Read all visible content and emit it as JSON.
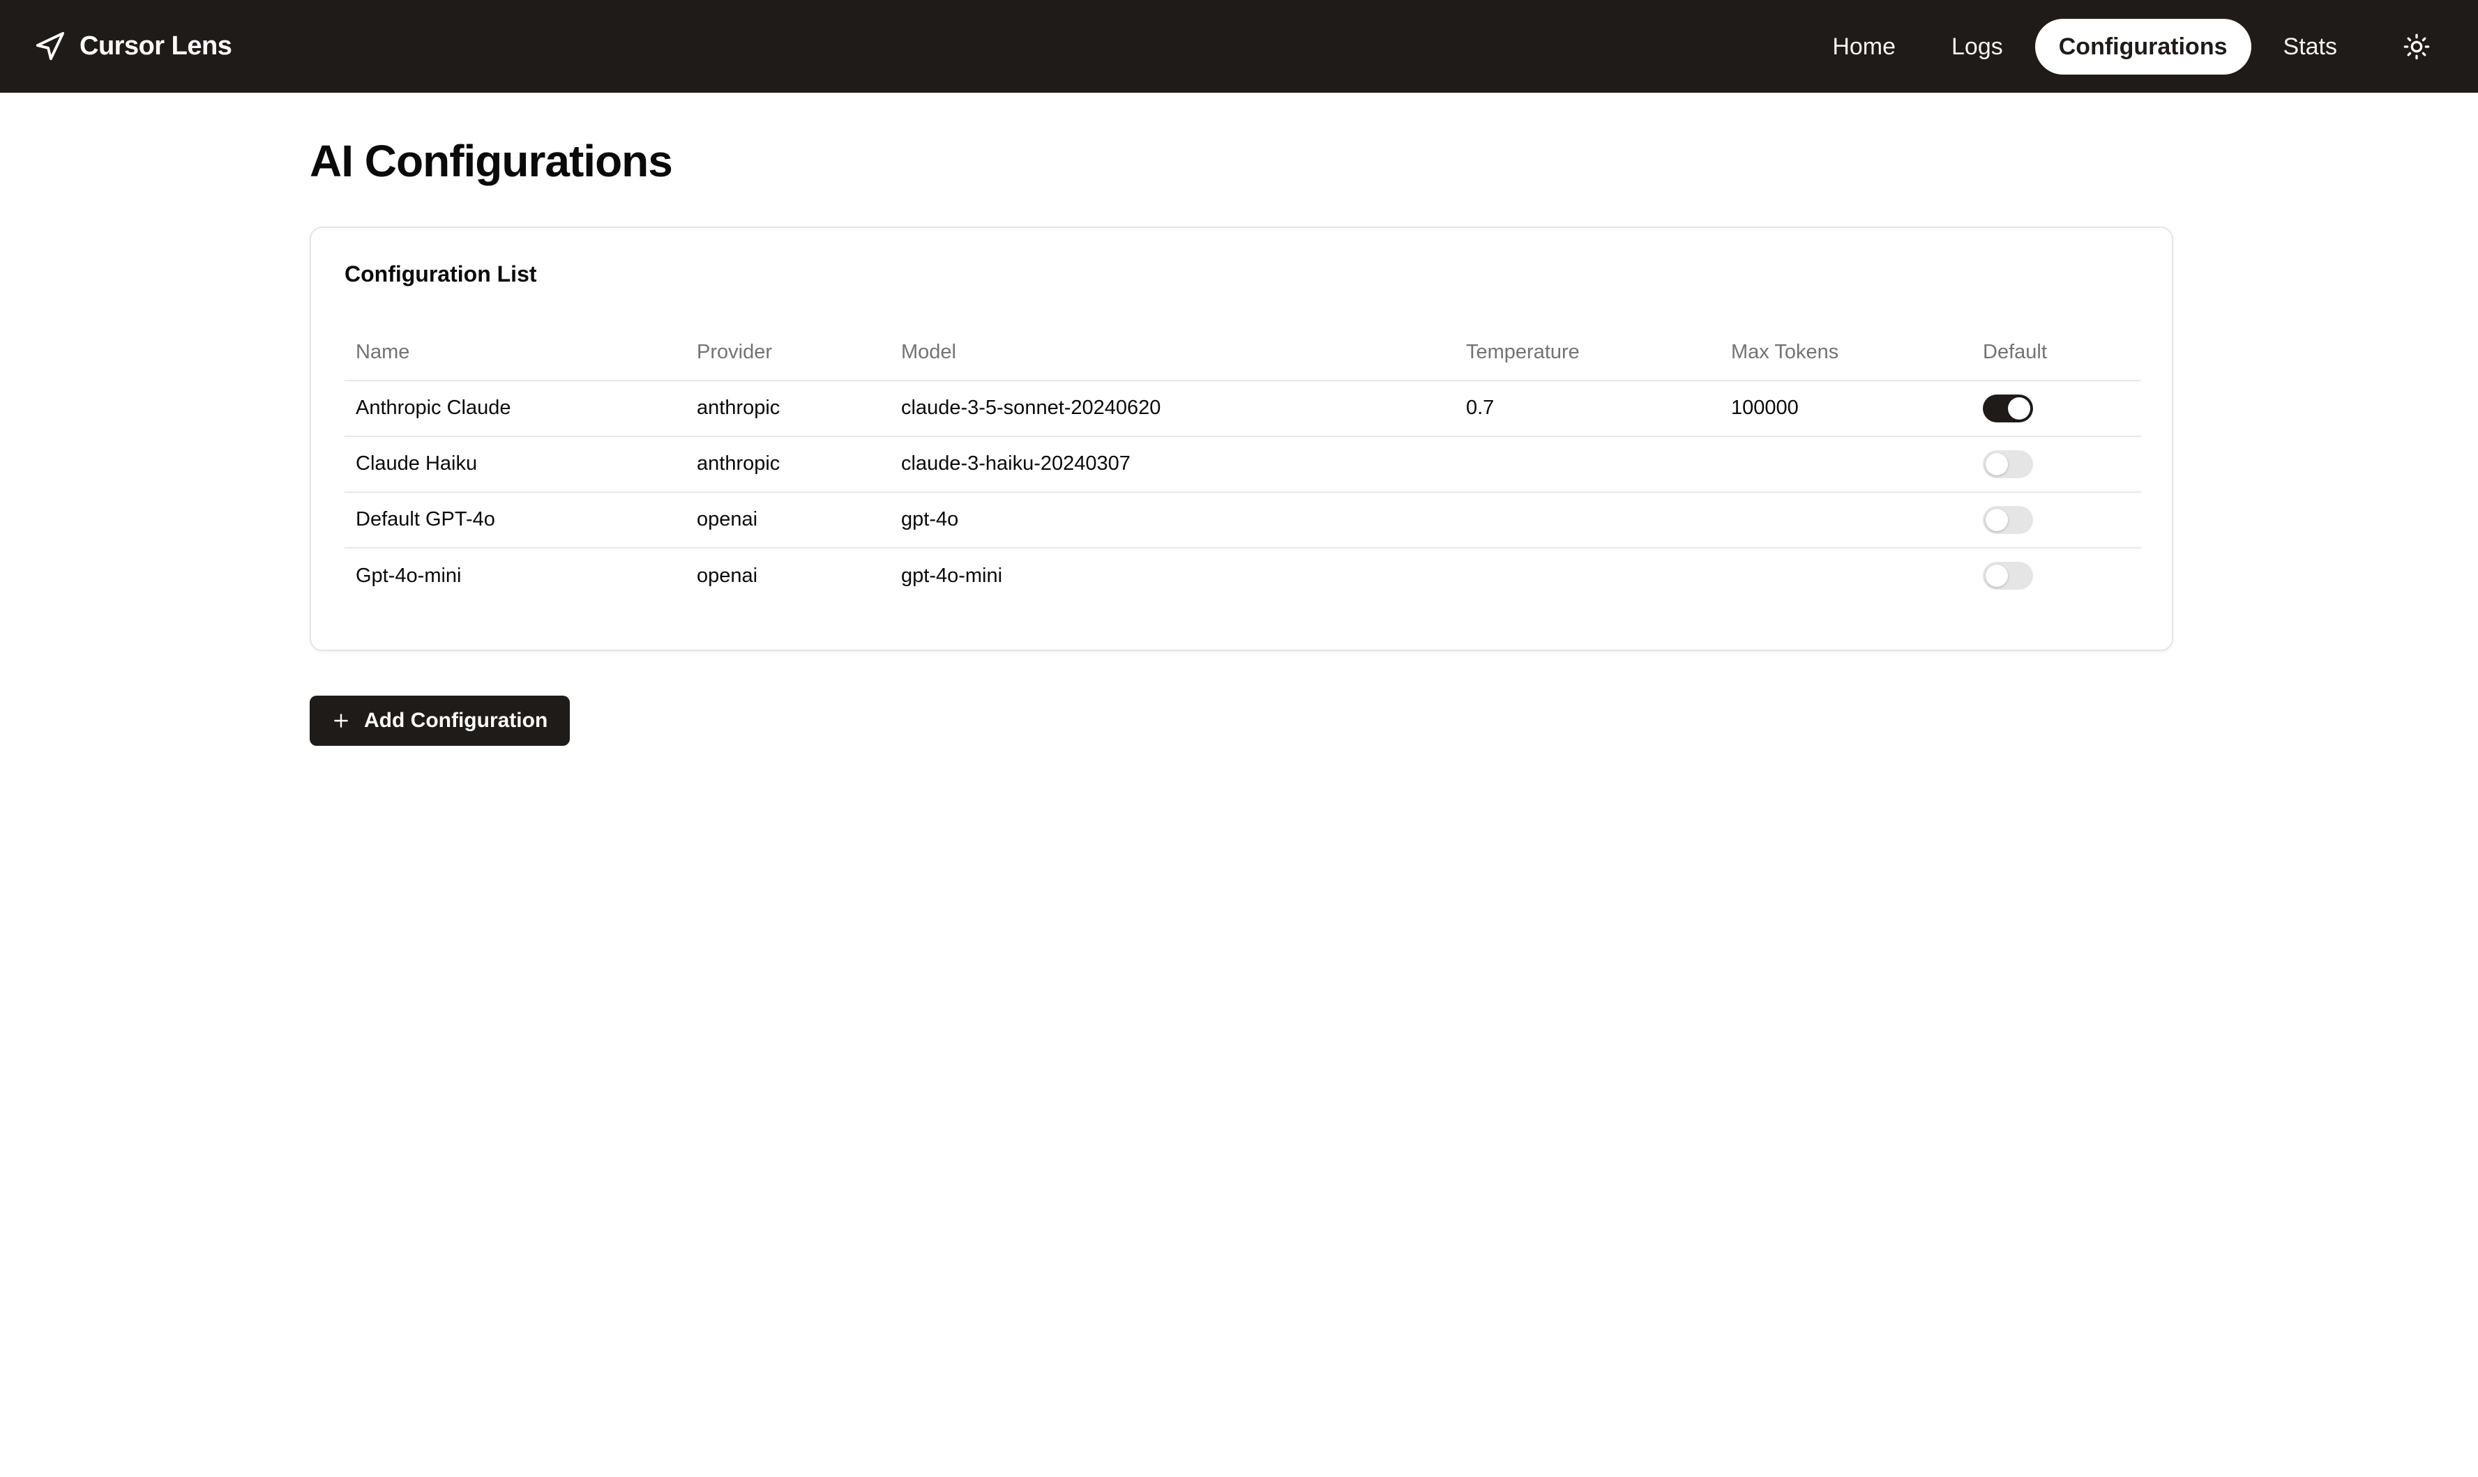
{
  "brand": {
    "name": "Cursor Lens",
    "icon": "navigation-arrow-icon"
  },
  "nav": {
    "items": [
      {
        "label": "Home",
        "active": false
      },
      {
        "label": "Logs",
        "active": false
      },
      {
        "label": "Configurations",
        "active": true
      },
      {
        "label": "Stats",
        "active": false
      }
    ],
    "theme_icon": "sun-icon"
  },
  "page": {
    "title": "AI Configurations"
  },
  "card": {
    "title": "Configuration List",
    "columns": [
      "Name",
      "Provider",
      "Model",
      "Temperature",
      "Max Tokens",
      "Default"
    ],
    "rows": [
      {
        "name": "Anthropic Claude",
        "provider": "anthropic",
        "model": "claude-3-5-sonnet-20240620",
        "temperature": "0.7",
        "max_tokens": "100000",
        "default": true
      },
      {
        "name": "Claude Haiku",
        "provider": "anthropic",
        "model": "claude-3-haiku-20240307",
        "temperature": "",
        "max_tokens": "",
        "default": false
      },
      {
        "name": "Default GPT-4o",
        "provider": "openai",
        "model": "gpt-4o",
        "temperature": "",
        "max_tokens": "",
        "default": false
      },
      {
        "name": "Gpt-4o-mini",
        "provider": "openai",
        "model": "gpt-4o-mini",
        "temperature": "",
        "max_tokens": "",
        "default": false
      }
    ]
  },
  "actions": {
    "add_label": "Add Configuration",
    "add_icon": "plus-icon"
  },
  "colors": {
    "nav_bg": "#1f1b18",
    "accent": "#1f1b18",
    "muted_text": "#737373",
    "border": "#e5e5e5"
  }
}
